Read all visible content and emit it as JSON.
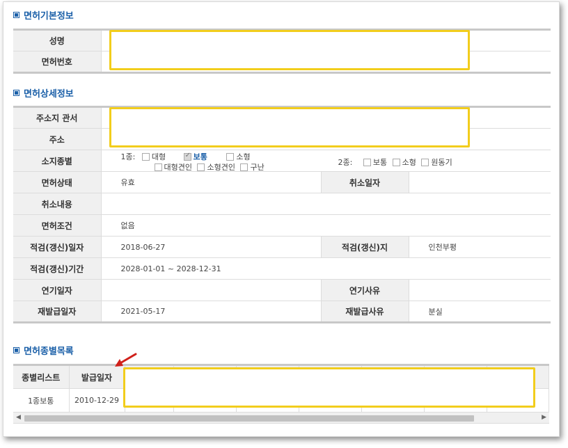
{
  "sections": {
    "basic": "면허기본정보",
    "detail": "면허상세정보",
    "list": "면허종별목록"
  },
  "basic": {
    "name_label": "성명",
    "license_no_label": "면허번호"
  },
  "detail": {
    "address_office_label": "주소지 관서",
    "address_label": "주소",
    "license_type_label": "소지종별",
    "type1_prefix": "1종:",
    "type1_options": [
      "대형",
      "보통",
      "소형",
      "대형견인",
      "소형견인",
      "구난"
    ],
    "type1_checked": "보통",
    "type2_prefix": "2종:",
    "type2_options": [
      "보통",
      "소형",
      "원동기"
    ],
    "status_label": "면허상태",
    "status_value": "유효",
    "cancel_date_label": "취소일자",
    "cancel_content_label": "취소내용",
    "condition_label": "면허조건",
    "condition_value": "없음",
    "renewal_date_label": "적검(갱신)일자",
    "renewal_date_value": "2018-06-27",
    "renewal_place_label": "적검(갱신)지",
    "renewal_place_value": "인천부평",
    "renewal_period_label": "적검(갱신)기간",
    "renewal_period_value": "2028-01-01 ~ 2028-12-31",
    "delay_date_label": "연기일자",
    "delay_reason_label": "연기사유",
    "reissue_date_label": "재발급일자",
    "reissue_date_value": "2021-05-17",
    "reissue_reason_label": "재발급사유",
    "reissue_reason_value": "분실"
  },
  "list": {
    "headers": [
      "종별리스트",
      "발급일자"
    ],
    "rows": [
      {
        "type": "1종보통",
        "date": "2010-12-29"
      }
    ]
  },
  "colors": {
    "accent_blue": "#1a5fa8",
    "highlight_yellow": "#f2cd1c",
    "annotation_red": "#d0201a"
  }
}
